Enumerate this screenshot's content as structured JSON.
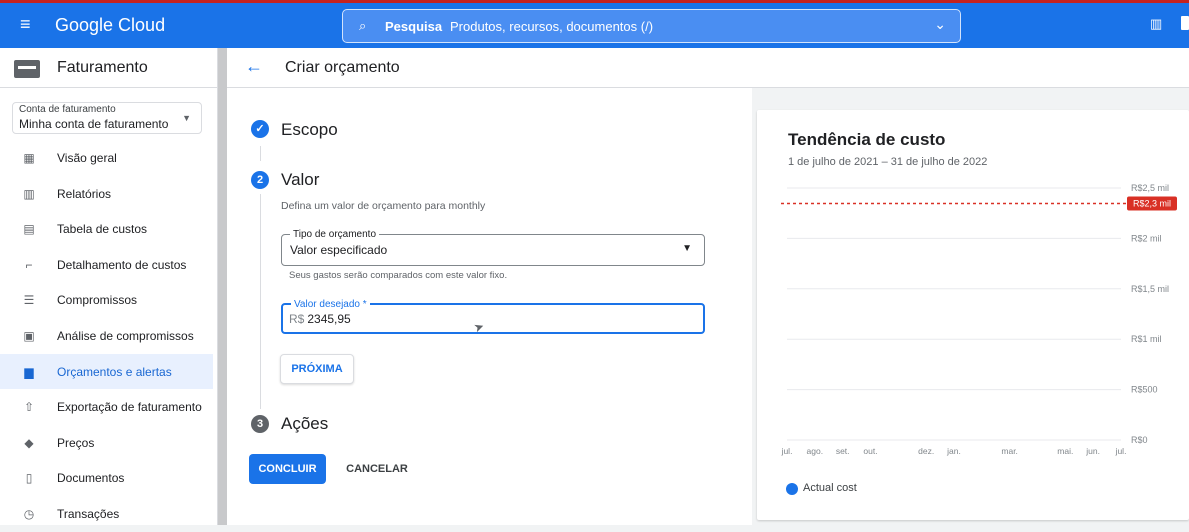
{
  "top_bar": {
    "brand": "Google Cloud",
    "search_label": "Pesquisa",
    "search_placeholder": "Produtos, recursos, documentos (/)",
    "accent": "#1a73e8"
  },
  "sidebar": {
    "title": "Faturamento",
    "account_label": "Conta de faturamento",
    "account_value": "Minha conta de faturamento",
    "items": [
      {
        "label": "Visão geral",
        "icon": "grid-icon"
      },
      {
        "label": "Relatórios",
        "icon": "bar-chart-icon"
      },
      {
        "label": "Tabela de custos",
        "icon": "table-icon"
      },
      {
        "label": "Detalhamento de custos",
        "icon": "breakdown-icon"
      },
      {
        "label": "Compromissos",
        "icon": "list-icon"
      },
      {
        "label": "Análise de compromissos",
        "icon": "analysis-icon"
      },
      {
        "label": "Orçamentos e alertas",
        "icon": "budget-icon",
        "active": true
      },
      {
        "label": "Exportação de faturamento",
        "icon": "upload-icon"
      },
      {
        "label": "Preços",
        "icon": "tag-icon"
      },
      {
        "label": "Documentos",
        "icon": "document-icon"
      },
      {
        "label": "Transações",
        "icon": "clock-icon"
      }
    ]
  },
  "page": {
    "title": "Criar orçamento"
  },
  "form": {
    "steps": {
      "scope": {
        "number": "✓",
        "title": "Escopo"
      },
      "value": {
        "number": "2",
        "title": "Valor"
      },
      "actions": {
        "number": "3",
        "title": "Ações"
      }
    },
    "helper": "Defina um valor de orçamento para monthly",
    "budget_type": {
      "label": "Tipo de orçamento",
      "value": "Valor especificado",
      "helper": "Seus gastos serão comparados com este valor fixo."
    },
    "target_amount": {
      "label": "Valor desejado *",
      "prefix": "R$",
      "value": "2345,95"
    },
    "next": "PRÓXIMA",
    "finish": "CONCLUIR",
    "cancel": "CANCELAR"
  },
  "chart_data": {
    "type": "line",
    "title": "Tendência de custo",
    "subtitle": "1 de julho de 2021 – 31 de julho de 2022",
    "x": [
      "jul.",
      "ago.",
      "set.",
      "out.",
      "",
      "dez.",
      "jan.",
      "",
      "mar.",
      "",
      "mai.",
      "jun.",
      "jul."
    ],
    "y_ticks": [
      "R$0",
      "R$500",
      "R$1 mil",
      "R$1,5 mil",
      "R$2 mil",
      "R$2,5 mil"
    ],
    "ylim": [
      0,
      2500
    ],
    "series": [
      {
        "name": "Actual cost",
        "values": [],
        "color": "#1a73e8"
      }
    ],
    "budget_line": {
      "value": 2345.95,
      "label": "R$2,3 mil",
      "color": "#d93025"
    },
    "legend": "bottom-left",
    "grid": true
  }
}
